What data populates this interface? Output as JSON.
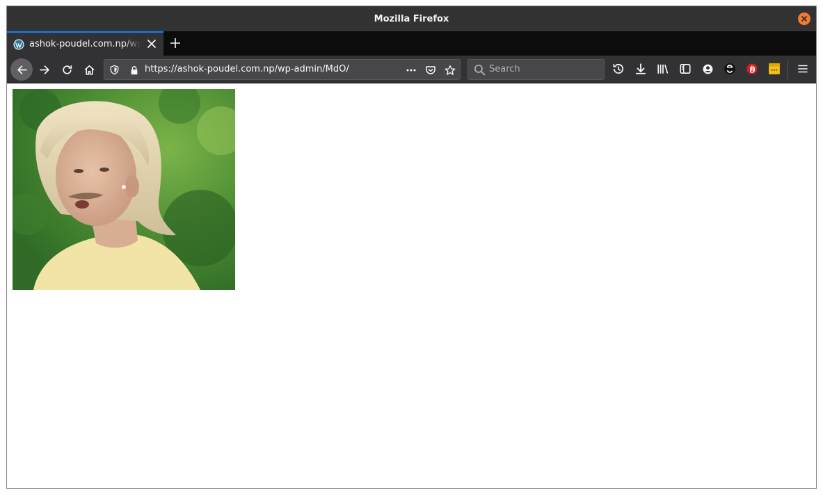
{
  "window": {
    "title": "Mozilla Firefox"
  },
  "tabs": [
    {
      "label": "ashok-poudel.com.np/wp-admin/MdO/",
      "active": true,
      "favicon": "wordpress-icon"
    }
  ],
  "navbar": {
    "url": "https://ashok-poudel.com.np/wp-admin/MdO/",
    "search_placeholder": "Search"
  },
  "toolbar_icons": [
    "history-icon",
    "download-icon",
    "library-icon",
    "sidebar-icon",
    "account-icon",
    "extension-icon",
    "ublock-icon",
    "notes-extension-icon",
    "menu-icon"
  ],
  "colors": {
    "accent": "#0a84ff",
    "close": "#f37b2f",
    "chrome": "#323234"
  },
  "page": {
    "image": "animated-gif-person"
  }
}
